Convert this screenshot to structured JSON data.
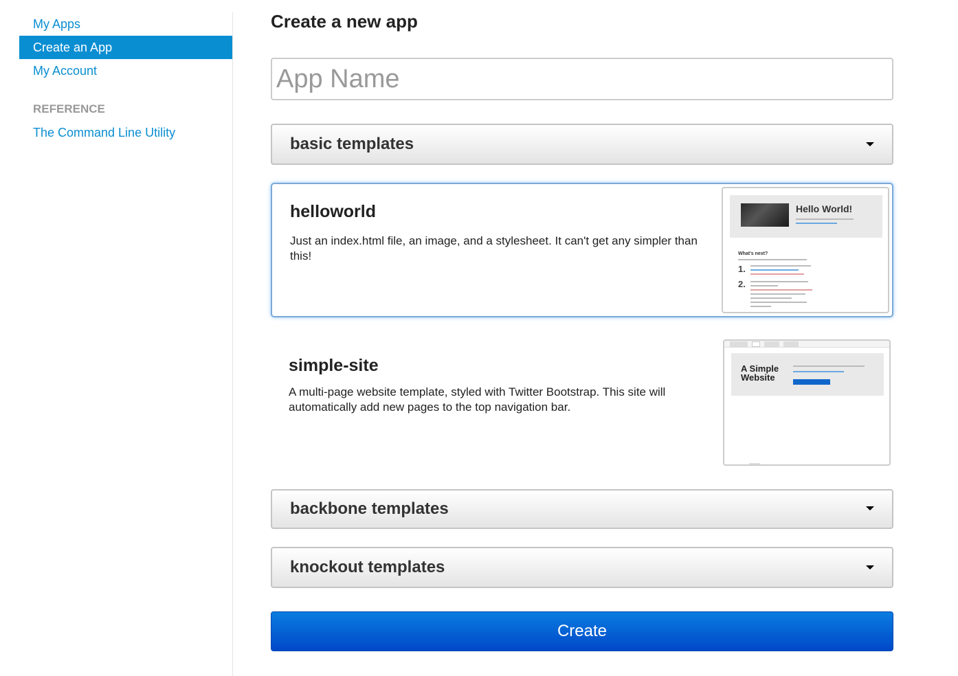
{
  "sidebar": {
    "items": [
      {
        "label": "My Apps",
        "active": false
      },
      {
        "label": "Create an App",
        "active": true
      },
      {
        "label": "My Account",
        "active": false
      }
    ],
    "reference_header": "REFERENCE",
    "reference_items": [
      {
        "label": "The Command Line Utility"
      }
    ]
  },
  "main": {
    "title": "Create a new app",
    "app_name_placeholder": "App Name",
    "template_groups": [
      {
        "label": "basic templates"
      },
      {
        "label": "backbone templates"
      },
      {
        "label": "knockout templates"
      }
    ],
    "templates": [
      {
        "name": "helloworld",
        "description": "Just an index.html file, an image, and a stylesheet. It can't get any simpler than this!",
        "selected": true,
        "thumbnail": {
          "hero_title": "Hello World!",
          "section_title": "What's next?",
          "steps": [
            "1.",
            "2."
          ]
        }
      },
      {
        "name": "simple-site",
        "description": "A multi-page website template, styled with Twitter Bootstrap. This site will automatically add new pages to the top navigation bar.",
        "selected": false,
        "thumbnail": {
          "hero_title": "A Simple Website"
        }
      }
    ],
    "create_label": "Create"
  },
  "colors": {
    "accent": "#0a8ed2",
    "button": "#0a64d6",
    "selected_border": "#7aa9d8"
  }
}
